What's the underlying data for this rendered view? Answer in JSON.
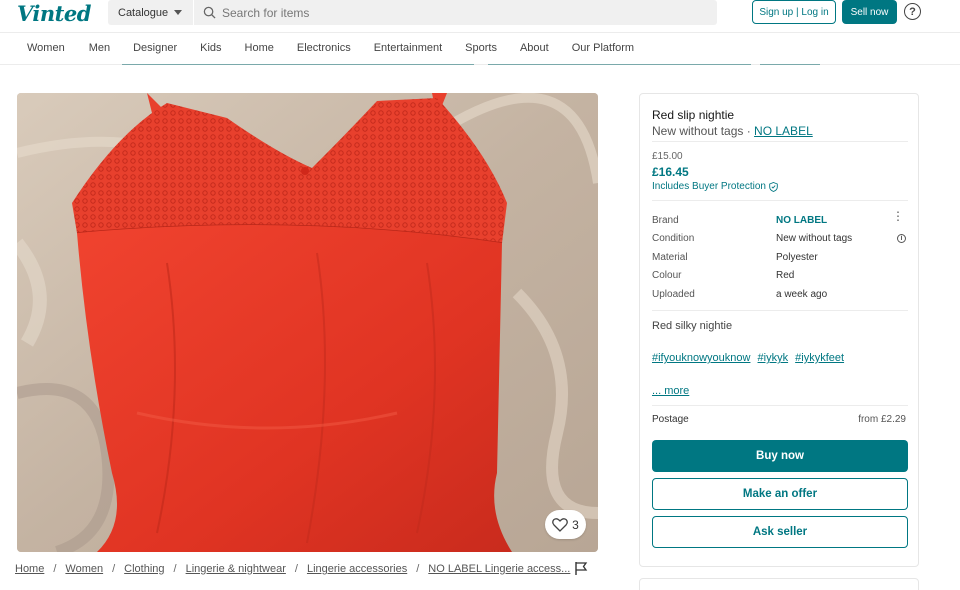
{
  "header": {
    "logo": "Vinted",
    "catalogue_label": "Catalogue",
    "search_placeholder": "Search for items",
    "signup_label": "Sign up | Log in",
    "sell_label": "Sell now",
    "help_label": "?"
  },
  "nav": {
    "items": [
      "Women",
      "Men",
      "Designer",
      "Kids",
      "Home",
      "Electronics",
      "Entertainment",
      "Sports",
      "About",
      "Our Platform"
    ]
  },
  "photo": {
    "favourite_count": "3"
  },
  "breadcrumb": [
    "Home",
    "Women",
    "Clothing",
    "Lingerie & nightwear",
    "Lingerie accessories",
    "NO LABEL Lingerie access..."
  ],
  "item": {
    "title": "Red slip nightie",
    "condition_prefix": "New without tags · ",
    "brand_link": "NO LABEL",
    "old_price": "£15.00",
    "price": "£16.45",
    "protection": "Includes Buyer Protection",
    "details": [
      {
        "label": "Brand",
        "value": "NO LABEL"
      },
      {
        "label": "Condition",
        "value": "New without tags"
      },
      {
        "label": "Material",
        "value": "Polyester"
      },
      {
        "label": "Colour",
        "value": "Red"
      },
      {
        "label": "Uploaded",
        "value": "a week ago"
      }
    ],
    "description": "Red silky nightie",
    "tags": [
      "#ifyouknowyouknow",
      "#iykyk",
      "#iykykfeet"
    ],
    "more": "... more",
    "postage_label": "Postage",
    "postage_price": "from £2.29",
    "buy_label": "Buy now",
    "offer_label": "Make an offer",
    "ask_label": "Ask seller"
  },
  "colors": {
    "brand": "#007782",
    "garment": "#e8382a",
    "background_fabric": "#cdbfb0"
  }
}
